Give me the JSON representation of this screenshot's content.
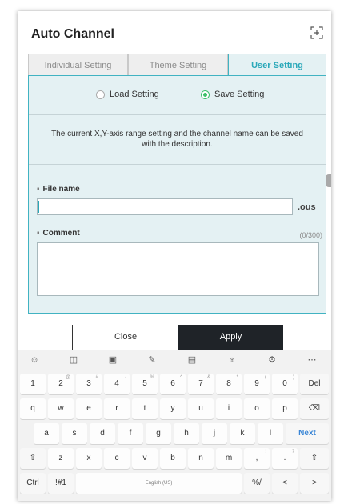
{
  "header": {
    "title": "Auto Channel"
  },
  "tabs": [
    {
      "label": "Individual Setting",
      "active": false
    },
    {
      "label": "Theme Setting",
      "active": false
    },
    {
      "label": "User Setting",
      "active": true
    }
  ],
  "radio": {
    "load_label": "Load Setting",
    "save_label": "Save Setting",
    "selected": "Save Setting"
  },
  "description": "The current X,Y-axis range setting and the channel name can be saved with the description.",
  "file": {
    "label": "File name",
    "value": "",
    "extension": ".ous"
  },
  "comment": {
    "label": "Comment",
    "counter": "(0/300)",
    "value": ""
  },
  "buttons": {
    "close": "Close",
    "apply": "Apply"
  },
  "keyboard": {
    "toolbar": [
      "emoji-icon",
      "sticker-icon",
      "gif-icon",
      "handwriting-icon",
      "clipboard-icon",
      "mic-icon",
      "settings-icon",
      "more-icon"
    ],
    "rows": [
      [
        {
          "label": "1"
        },
        {
          "label": "2",
          "hint": "@"
        },
        {
          "label": "3",
          "hint": "#"
        },
        {
          "label": "4",
          "hint": "/"
        },
        {
          "label": "5",
          "hint": "%"
        },
        {
          "label": "6",
          "hint": "^"
        },
        {
          "label": "7",
          "hint": "&"
        },
        {
          "label": "8",
          "hint": "*"
        },
        {
          "label": "9",
          "hint": "("
        },
        {
          "label": "0",
          "hint": ")"
        },
        {
          "label": "Del"
        }
      ],
      [
        {
          "label": "q"
        },
        {
          "label": "w"
        },
        {
          "label": "e"
        },
        {
          "label": "r"
        },
        {
          "label": "t"
        },
        {
          "label": "y"
        },
        {
          "label": "u"
        },
        {
          "label": "i"
        },
        {
          "label": "o"
        },
        {
          "label": "p"
        },
        {
          "label": "⌫"
        }
      ],
      [
        {
          "label": "a"
        },
        {
          "label": "s"
        },
        {
          "label": "d"
        },
        {
          "label": "f"
        },
        {
          "label": "g"
        },
        {
          "label": "h"
        },
        {
          "label": "j"
        },
        {
          "label": "k"
        },
        {
          "label": "l"
        },
        {
          "label": "Next"
        }
      ],
      [
        {
          "label": "⇧"
        },
        {
          "label": "z"
        },
        {
          "label": "x"
        },
        {
          "label": "c"
        },
        {
          "label": "v"
        },
        {
          "label": "b"
        },
        {
          "label": "n"
        },
        {
          "label": "m"
        },
        {
          "label": ",",
          "hint": "!"
        },
        {
          "label": ".",
          "hint": "?"
        },
        {
          "label": "⇧"
        }
      ],
      [
        {
          "label": "Ctrl"
        },
        {
          "label": "!#1"
        },
        {
          "label": "English (US)"
        },
        {
          "label": "%/"
        },
        {
          "label": "<"
        },
        {
          "label": ">"
        }
      ]
    ]
  }
}
